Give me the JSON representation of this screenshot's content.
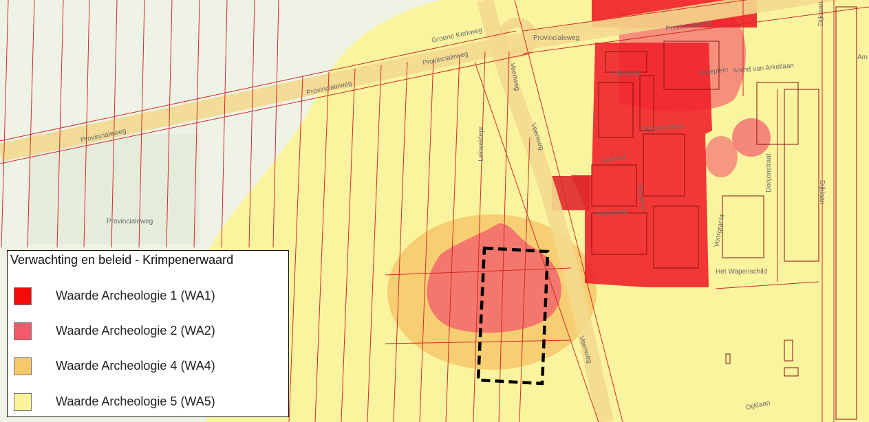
{
  "map": {
    "streets": {
      "provincialeweg_1": "Provincialeweg",
      "provincialeweg_2": "Provincialeweg",
      "provincialeweg_3": "Provincialeweg",
      "provincialeweg_4": "Provincialeweg",
      "provincialeweg_5": "Provincialeweg",
      "provincialeweg_6": "Provincialeweg",
      "groene_kerkweg": "Groene Kerkweg",
      "veenweg_1": "Veenweg",
      "veenweg_2": "Veenweg",
      "veenweg_3": "Veenweg",
      "lekweidepr": "Lekweidepr",
      "palissade": "Palissade",
      "terreplein": "Terreplein",
      "arend_van_arkellaan": "Arend van Arkellaan",
      "slotgrachtlaan": "Slotgrachtlaan",
      "kanteel": "Kanteel",
      "traverse": "Traverse",
      "weergang": "Weergang",
      "voorgracht": "Voorgracht",
      "het_wapenschild": "Het Wapenschild",
      "donjonstraat": "Donjonstraat",
      "dijklaan_1": "Dijklaan",
      "dijklaan_2": "Dijklaan",
      "dijklaan_3": "Dijklaan",
      "am": "Am"
    },
    "colors": {
      "wa1": "#f01e28",
      "wa2": "#f25a6b",
      "wa4": "#f6c86a",
      "wa5": "#fbf39a",
      "parcel_line": "#d42828",
      "study_area_border": "#000000"
    }
  },
  "legend": {
    "title": "Verwachting en beleid - Krimpenerwaard",
    "items": [
      {
        "label": "Waarde Archeologie 1 (WA1)",
        "color": "#f50a0a"
      },
      {
        "label": "Waarde Archeologie 2 (WA2)",
        "color": "#f25a6b"
      },
      {
        "label": "Waarde Archeologie 4 (WA4)",
        "color": "#f6c86a"
      },
      {
        "label": "Waarde Archeologie 5 (WA5)",
        "color": "#fbf39a"
      }
    ]
  }
}
